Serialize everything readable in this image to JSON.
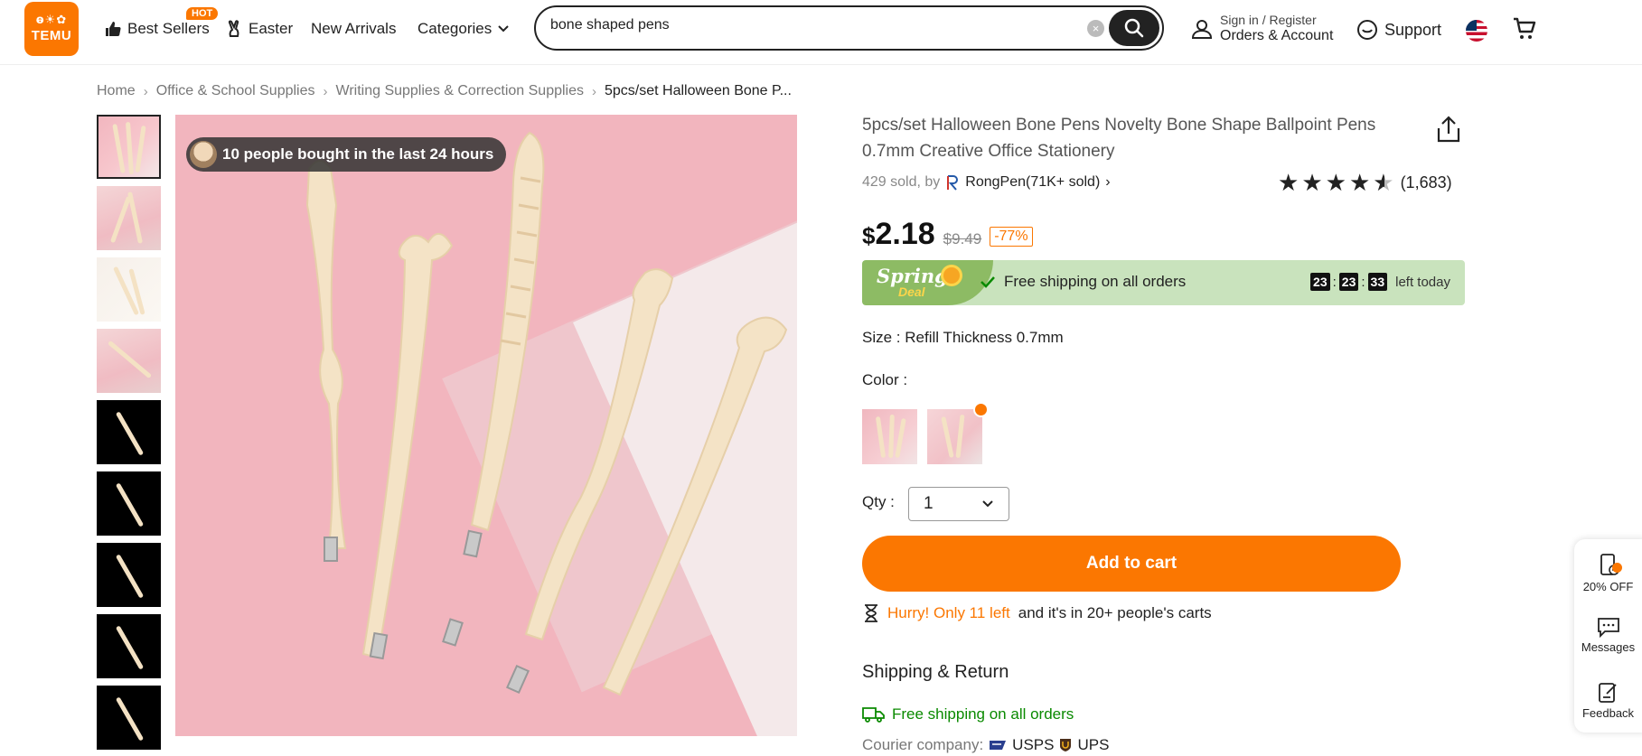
{
  "header": {
    "logo_top": "ⱺ☀✿",
    "logo_text": "TEMU",
    "nav": [
      {
        "label": "Best Sellers",
        "badge": "HOT"
      },
      {
        "label": "Easter"
      },
      {
        "label": "New Arrivals"
      },
      {
        "label": "Categories"
      }
    ],
    "search_value": "bone shaped pens",
    "account_line1": "Sign in / Register",
    "account_line2": "Orders & Account",
    "support": "Support"
  },
  "breadcrumb": [
    "Home",
    "Office & School Supplies",
    "Writing Supplies & Correction Supplies",
    "5pcs/set Halloween Bone P..."
  ],
  "gallery": {
    "badge": "10 people bought in the last 24 hours",
    "thumb_count": 9
  },
  "product": {
    "title": "5pcs/set Halloween Bone Pens Novelty Bone Shape Ballpoint Pens 0.7mm Creative Office Stationery",
    "sold": "429 sold, by",
    "store": "RongPen(71K+ sold)",
    "rating": 4.5,
    "reviews": "(1,683)",
    "price_symbol": "$",
    "price": "2.18",
    "original_price": "$9.49",
    "discount": "-77%",
    "deal_line1": "Spring",
    "deal_line2": "Deal",
    "free_shipping": "Free shipping on all orders",
    "timer": [
      "23",
      "23",
      "33"
    ],
    "timer_suffix": "left today",
    "size_label": "Size :",
    "size_value": "Refill Thickness 0.7mm",
    "color_label": "Color :",
    "qty_label": "Qty :",
    "qty_value": "1",
    "add_to_cart": "Add to cart",
    "hurry_highlight": "Hurry! Only 11 left",
    "hurry_rest": "and it's in 20+ people's carts",
    "shipping_title": "Shipping & Return",
    "shipping_line": "Free shipping on all orders",
    "courier_label": "Courier company:",
    "couriers": [
      "USPS",
      "UPS"
    ]
  },
  "float_panel": {
    "items": [
      "20% OFF",
      "Messages",
      "Feedback"
    ]
  },
  "colors": {
    "accent": "#fb7701",
    "deal_green": "#c9e3bd",
    "ship_green": "#0a8a00"
  }
}
